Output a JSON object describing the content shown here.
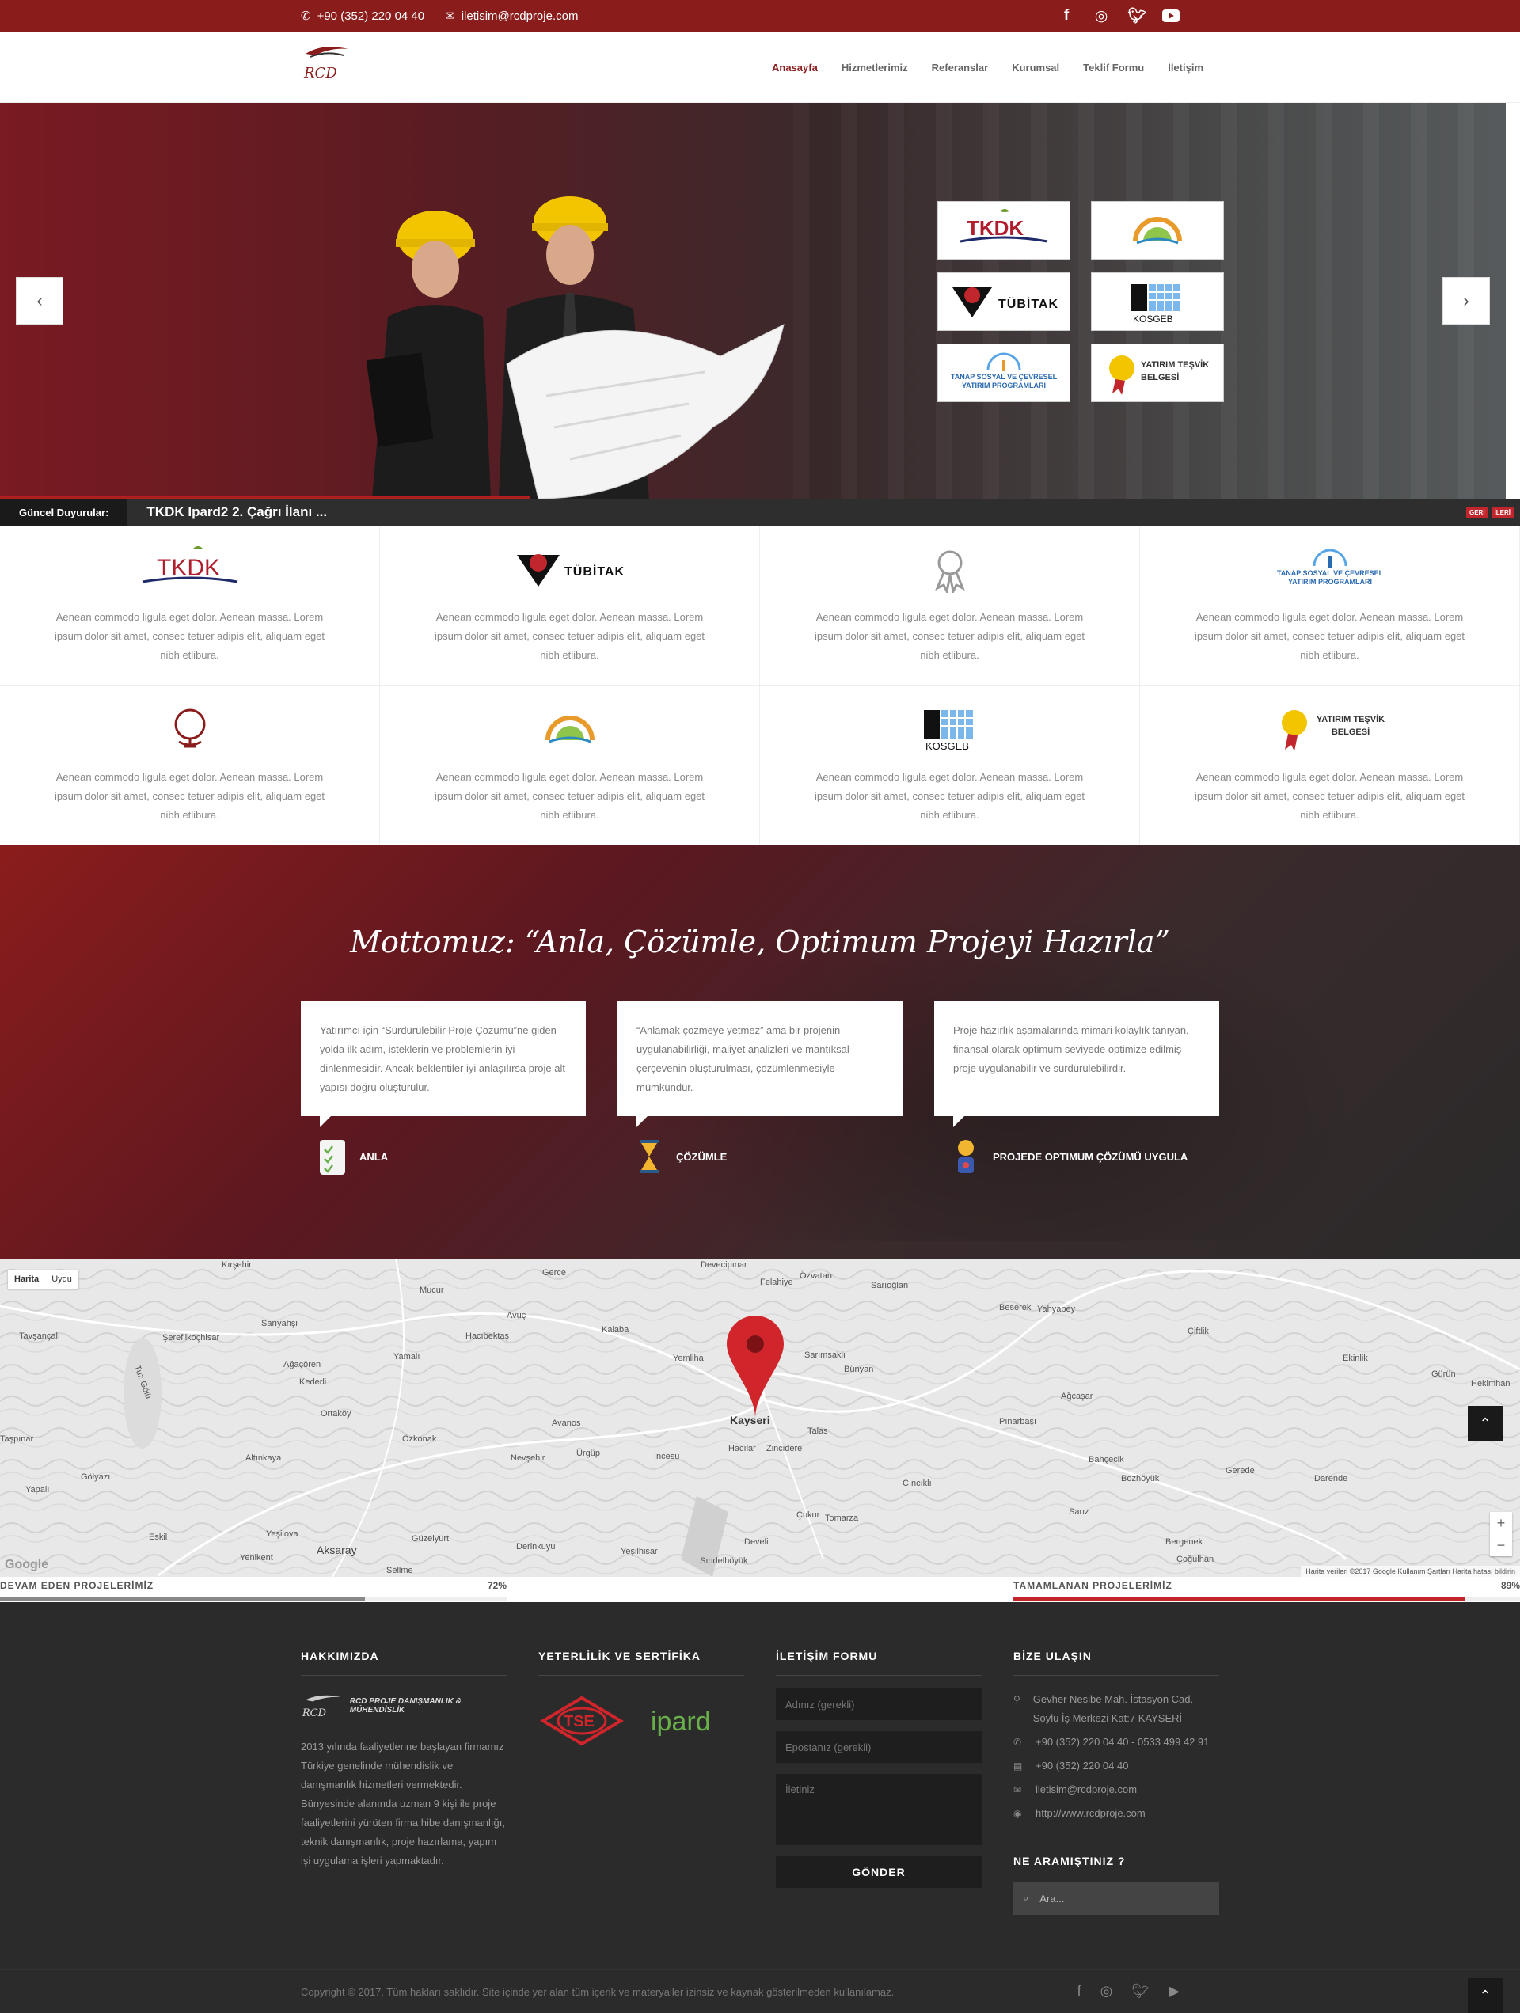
{
  "topbar": {
    "phone": "+90 (352) 220 04 40",
    "email": "iletisim@rcdproje.com",
    "social": [
      "facebook-icon",
      "instagram-icon",
      "twitter-icon",
      "youtube-icon"
    ]
  },
  "header": {
    "logo_text": "RCD",
    "nav": [
      {
        "label": "Anasayfa",
        "active": true
      },
      {
        "label": "Hizmetlerimiz"
      },
      {
        "label": "Referanslar"
      },
      {
        "label": "Kurumsal"
      },
      {
        "label": "Teklif Formu"
      },
      {
        "label": "İletişim"
      }
    ]
  },
  "hero": {
    "logos": [
      "TKDK",
      "",
      "TÜBİTAK",
      "KOSGEB",
      "TANAP SOSYAL VE ÇEVRESEL YATIRIM PROGRAMLARI",
      "YATIRIM TEŞVİK BELGESİ"
    ]
  },
  "ticker": {
    "label": "Güncel Duyurular:",
    "text": "TKDK Ipard2 2. Çağrı İlanı ...",
    "prev": "GERİ",
    "next": "İLERİ"
  },
  "features": {
    "text": "Aenean commodo ligula eget dolor. Aenean massa. Lorem ipsum dolor sit amet, consec tetuer adipis elit, aliquam eget nibh etlibura.",
    "items": [
      {
        "logo": "TKDK"
      },
      {
        "logo": "TÜBİTAK"
      },
      {
        "logo": ""
      },
      {
        "logo": "TANAP SOSYAL VE ÇEVRESEL YATIRIM PROGRAMLARI"
      },
      {
        "logo": ""
      },
      {
        "logo": ""
      },
      {
        "logo": "KOSGEB"
      },
      {
        "logo": "YATIRIM TEŞVİK BELGESİ"
      }
    ]
  },
  "motto": {
    "title": "Mottomuz: “Anla, Çözümle, Optimum Projeyi Hazırla”",
    "cards": [
      {
        "text": "Yatırımcı için “Sürdürülebilir Proje Çözümü”ne giden yolda ilk adım, isteklerin ve problemlerin iyi dinlenmesidir. Ancak beklentiler iyi anlaşılırsa proje alt yapısı doğru oluşturulur.",
        "label": "ANLA"
      },
      {
        "text": "“Anlamak çözmeye yetmez” ama bir projenin uygulanabilirliği, maliyet analizleri ve mantıksal çerçevenin oluşturulması, çözümlenmesiyle mümkündür.",
        "label": "ÇÖZÜMLE"
      },
      {
        "text": "Proje hazırlık aşamalarında mimari kolaylık tanıyan, finansal olarak optimum seviyede optimize edilmiş proje uygulanabilir ve sürdürülebilirdir.",
        "label": "PROJEDE OPTIMUM ÇÖZÜMÜ UYGULA"
      }
    ]
  },
  "map": {
    "tab_map": "Harita",
    "tab_sat": "Uydu",
    "center_city": "Kayseri",
    "cities": [
      "Kırşehir",
      "Gerce",
      "Devecipınar",
      "Özvatan",
      "Felahiye",
      "Sarıoğlan",
      "Beserek",
      "Yahyabey",
      "Mucur",
      "Avuç",
      "Hacıbektaş",
      "Kalaba",
      "Yemliha",
      "Sarımsaklı",
      "Bünyan",
      "Şereflikoçhisar",
      "Sarıyahşi",
      "Yamalı",
      "Ağaçören",
      "Kederli",
      "Ortaköy",
      "Özkonak",
      "Avanos",
      "Nevşehir",
      "Ürgüp",
      "İncesu",
      "Hacılar",
      "Zincidere",
      "Talas",
      "Pınarbaşı",
      "Tavşançalı",
      "Tuz Gölü",
      "Taşpınar",
      "Altınkaya",
      "Yeşilova",
      "Eskil",
      "Yenikent",
      "Aksaray",
      "Sellme",
      "Güzelyurt",
      "Derinkuyu",
      "Yeşilhisar",
      "Develi",
      "Tomarza",
      "Sındelhöyük",
      "Çukur",
      "Bahçecik",
      "Bozhöyük",
      "Darende",
      "Bergenek",
      "Çoğulhan",
      "Ekinlik",
      "Gürün",
      "Hekimhan",
      "Ağcaşar",
      "Sarız",
      "Çiftlik",
      "Yapalı",
      "Gölyazı",
      "Cıncıklı",
      "Gerede"
    ],
    "attr": "Harita verileri ©2017 Google   Kullanım Şartları   Harita hatası bildirin",
    "google": "Google",
    "zoom_in": "+",
    "zoom_out": "−"
  },
  "progress": [
    {
      "label": "DEVAM EDEN PROJELERİMİZ",
      "pct": "72%",
      "value": 0.72,
      "color": "#888888"
    },
    {
      "label": "TAMAMLANAN PROJELERİMİZ",
      "pct": "89%",
      "value": 0.89,
      "color": "#c0262b"
    }
  ],
  "footer": {
    "about": {
      "title": "HAKKIMIZDA",
      "logo_text": "RCD PROJE DANIŞMANLIK & MÜHENDİSLİK",
      "text": "2013 yılında faaliyetlerine başlayan firmamız Türkiye genelinde mühendislik ve danışmanlık hizmetleri vermektedir. Bünyesinde alanında uzman 9 kişi ile proje faaliyetlerini yürüten firma hibe danışmanlığı, teknik danışmanlık, proje hazırlama, yapım işi uygulama işleri yapmaktadır."
    },
    "certs": {
      "title": "YETERLİLİK VE SERTİFİKA",
      "tse": "TSE",
      "ipard": "ipard"
    },
    "form": {
      "title": "İLETİŞİM FORMU",
      "name_ph": "Adınız (gerekli)",
      "email_ph": "Epostanız (gerekli)",
      "msg_ph": "İletiniz",
      "submit": "GÖNDER"
    },
    "contact": {
      "title": "BİZE ULAŞIN",
      "address": "Gevher Nesibe Mah. İstasyon Cad. Soylu İş Merkezi Kat:7 KAYSERİ",
      "phones": "+90 (352) 220 04 40 - 0533 499 42 91",
      "fax": "+90 (352) 220 04 40",
      "email": "iletisim@rcdproje.com",
      "web": "http://www.rcdproje.com"
    },
    "search": {
      "title": "NE ARAMIŞTINIZ ?",
      "placeholder": "Ara..."
    }
  },
  "copyright": "Copyright © 2017. Tüm hakları saklıdır. Site içinde yer alan tüm içerik ve materyaller izinsiz ve kaynak gösterilmeden kullanılamaz."
}
